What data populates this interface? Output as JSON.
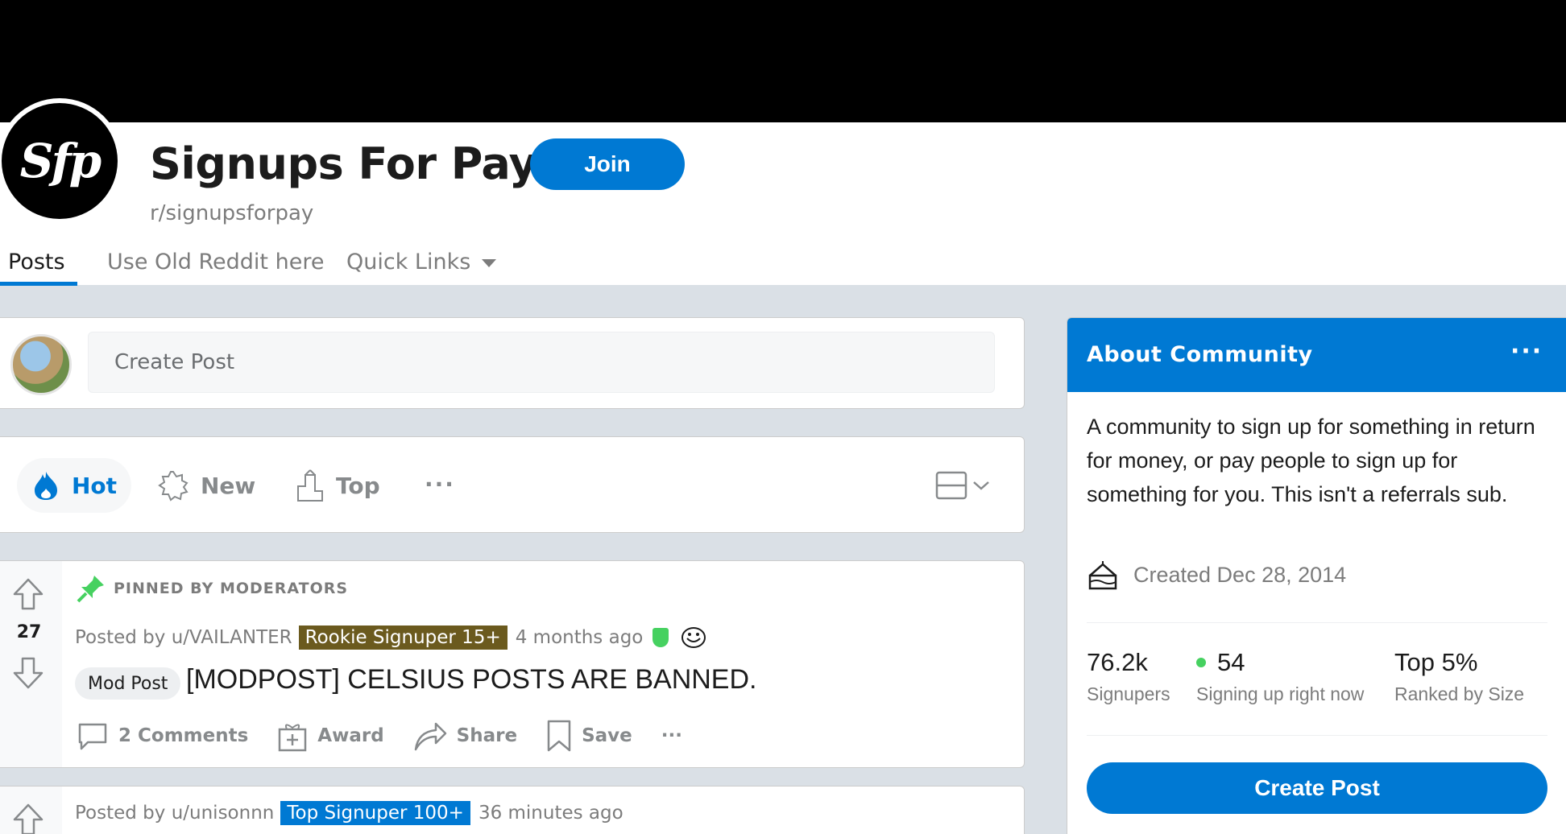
{
  "subreddit": {
    "logo_text": "Sfp",
    "title": "Signups For Pay",
    "join_label": "Join",
    "name": "r/signupsforpay"
  },
  "tabs": [
    {
      "label": "Posts",
      "active": true
    },
    {
      "label": "Use Old Reddit here",
      "active": false
    },
    {
      "label": "Quick Links",
      "active": false
    }
  ],
  "create_post": {
    "placeholder": "Create Post"
  },
  "sort": {
    "items": [
      {
        "label": "Hot",
        "active": true,
        "icon": "flame-icon"
      },
      {
        "label": "New",
        "icon": "burst-icon"
      },
      {
        "label": "Top",
        "icon": "podium-icon"
      }
    ],
    "more": "···"
  },
  "posts": [
    {
      "pinned_label": "PINNED BY MODERATORS",
      "votes": "27",
      "posted_by": "Posted by u/VAILANTER",
      "flair": "Rookie Signuper 15+",
      "time": "4 months ago",
      "tag": "Mod Post",
      "title": "[MODPOST] CELSIUS POSTS ARE BANNED.",
      "actions": {
        "comments": "2 Comments",
        "award": "Award",
        "share": "Share",
        "save": "Save",
        "more": "···"
      }
    },
    {
      "posted_by": "Posted by u/unisonnn",
      "flair": "Top Signuper 100+",
      "time": "36 minutes ago"
    }
  ],
  "about": {
    "title": "About Community",
    "more": "···",
    "description": "A community to sign up for something in return for money, or pay people to sign up for something for you. This isn't a referrals sub.",
    "created": "Created Dec 28, 2014",
    "stats": [
      {
        "value": "76.2k",
        "label": "Signupers"
      },
      {
        "value": "54",
        "label": "Signing up right now"
      },
      {
        "value": "Top 5%",
        "label": "Ranked by Size"
      }
    ],
    "create_label": "Create Post"
  },
  "colors": {
    "accent": "#0079d3",
    "online": "#46d160",
    "rookie_flair": "#6b5a1e"
  }
}
